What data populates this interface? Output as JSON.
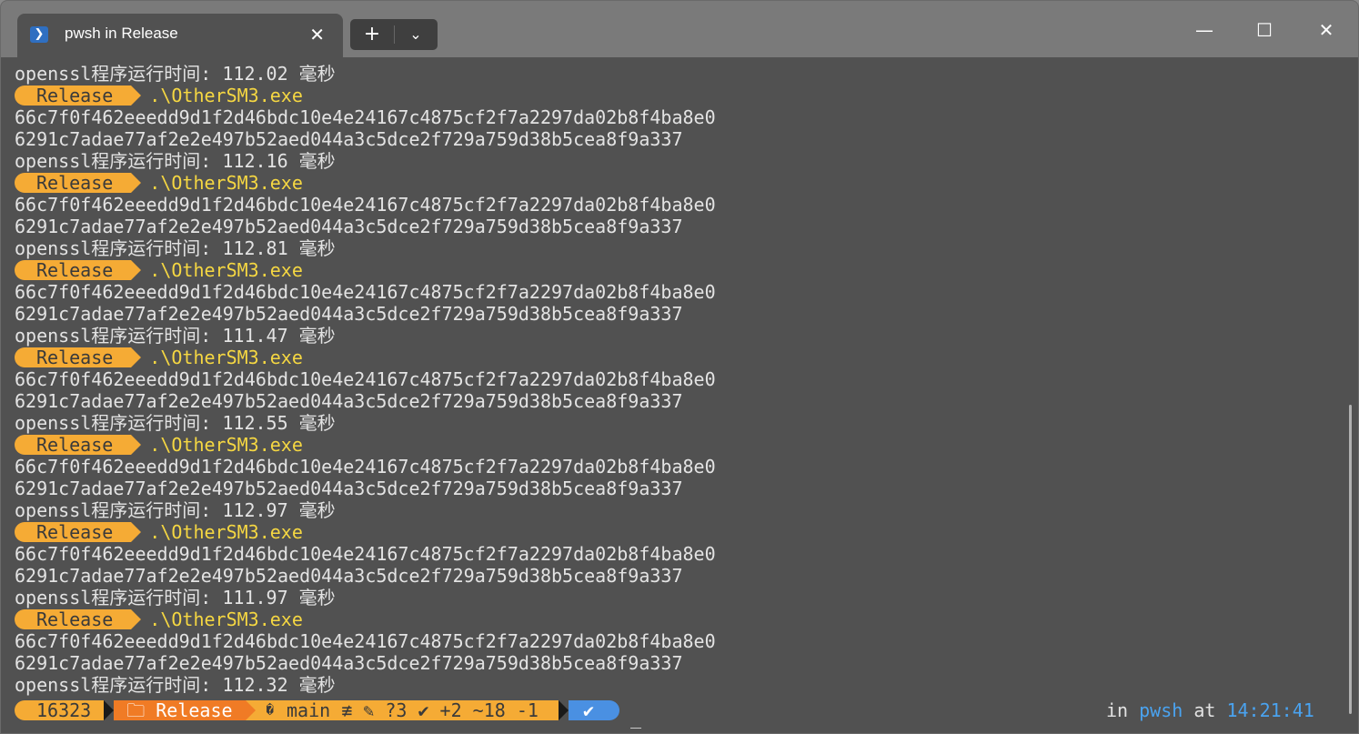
{
  "window": {
    "tab_title": "pwsh in Release",
    "tab_icon": "powershell-icon",
    "new_tab_icon": "plus-icon",
    "dropdown_icon": "chevron-down-icon",
    "controls": {
      "minimize": "—",
      "maximize": "☐",
      "close": "✕"
    }
  },
  "terminal": {
    "first_line": "openssl程序运行时间: 112.02 毫秒",
    "runs": [
      {
        "badge": "Release",
        "cmd": ".\\OtherSM3.exe",
        "hash1": "66c7f0f462eeedd9d1f2d46bdc10e4e24167c4875cf2f7a2297da02b8f4ba8e0",
        "hash2": "6291c7adae77af2e2e497b52aed044a3c5dce2f729a759d38b5cea8f9a337",
        "timing": "openssl程序运行时间: 112.16 毫秒"
      },
      {
        "badge": "Release",
        "cmd": ".\\OtherSM3.exe",
        "hash1": "66c7f0f462eeedd9d1f2d46bdc10e4e24167c4875cf2f7a2297da02b8f4ba8e0",
        "hash2": "6291c7adae77af2e2e497b52aed044a3c5dce2f729a759d38b5cea8f9a337",
        "timing": "openssl程序运行时间: 112.81 毫秒"
      },
      {
        "badge": "Release",
        "cmd": ".\\OtherSM3.exe",
        "hash1": "66c7f0f462eeedd9d1f2d46bdc10e4e24167c4875cf2f7a2297da02b8f4ba8e0",
        "hash2": "6291c7adae77af2e2e497b52aed044a3c5dce2f729a759d38b5cea8f9a337",
        "timing": "openssl程序运行时间: 111.47 毫秒"
      },
      {
        "badge": "Release",
        "cmd": ".\\OtherSM3.exe",
        "hash1": "66c7f0f462eeedd9d1f2d46bdc10e4e24167c4875cf2f7a2297da02b8f4ba8e0",
        "hash2": "6291c7adae77af2e2e497b52aed044a3c5dce2f729a759d38b5cea8f9a337",
        "timing": "openssl程序运行时间: 112.55 毫秒"
      },
      {
        "badge": "Release",
        "cmd": ".\\OtherSM3.exe",
        "hash1": "66c7f0f462eeedd9d1f2d46bdc10e4e24167c4875cf2f7a2297da02b8f4ba8e0",
        "hash2": "6291c7adae77af2e2e497b52aed044a3c5dce2f729a759d38b5cea8f9a337",
        "timing": "openssl程序运行时间: 112.97 毫秒"
      },
      {
        "badge": "Release",
        "cmd": ".\\OtherSM3.exe",
        "hash1": "66c7f0f462eeedd9d1f2d46bdc10e4e24167c4875cf2f7a2297da02b8f4ba8e0",
        "hash2": "6291c7adae77af2e2e497b52aed044a3c5dce2f729a759d38b5cea8f9a337",
        "timing": "openssl程序运行时间: 111.97 毫秒"
      },
      {
        "badge": "Release",
        "cmd": ".\\OtherSM3.exe",
        "hash1": "66c7f0f462eeedd9d1f2d46bdc10e4e24167c4875cf2f7a2297da02b8f4ba8e0",
        "hash2": "6291c7adae77af2e2e497b52aed044a3c5dce2f729a759d38b5cea8f9a337",
        "timing": "openssl程序运行时间: 112.32 毫秒"
      }
    ]
  },
  "prompt": {
    "count": "16323",
    "folder": "🗀 Release",
    "git_icon": "�",
    "git": "main ≢ ✎ ?3 ✔ +2 ~18 -1",
    "ok": "✔",
    "cursor": "_",
    "right_in": "in ",
    "right_shell": "pwsh",
    "right_at": " at ",
    "right_time": "14:21:41"
  },
  "colors": {
    "background": "#515151",
    "badge": "#f5ab35",
    "path": "#f07b25",
    "ok": "#4a90e2",
    "cmd": "#f5d742"
  }
}
